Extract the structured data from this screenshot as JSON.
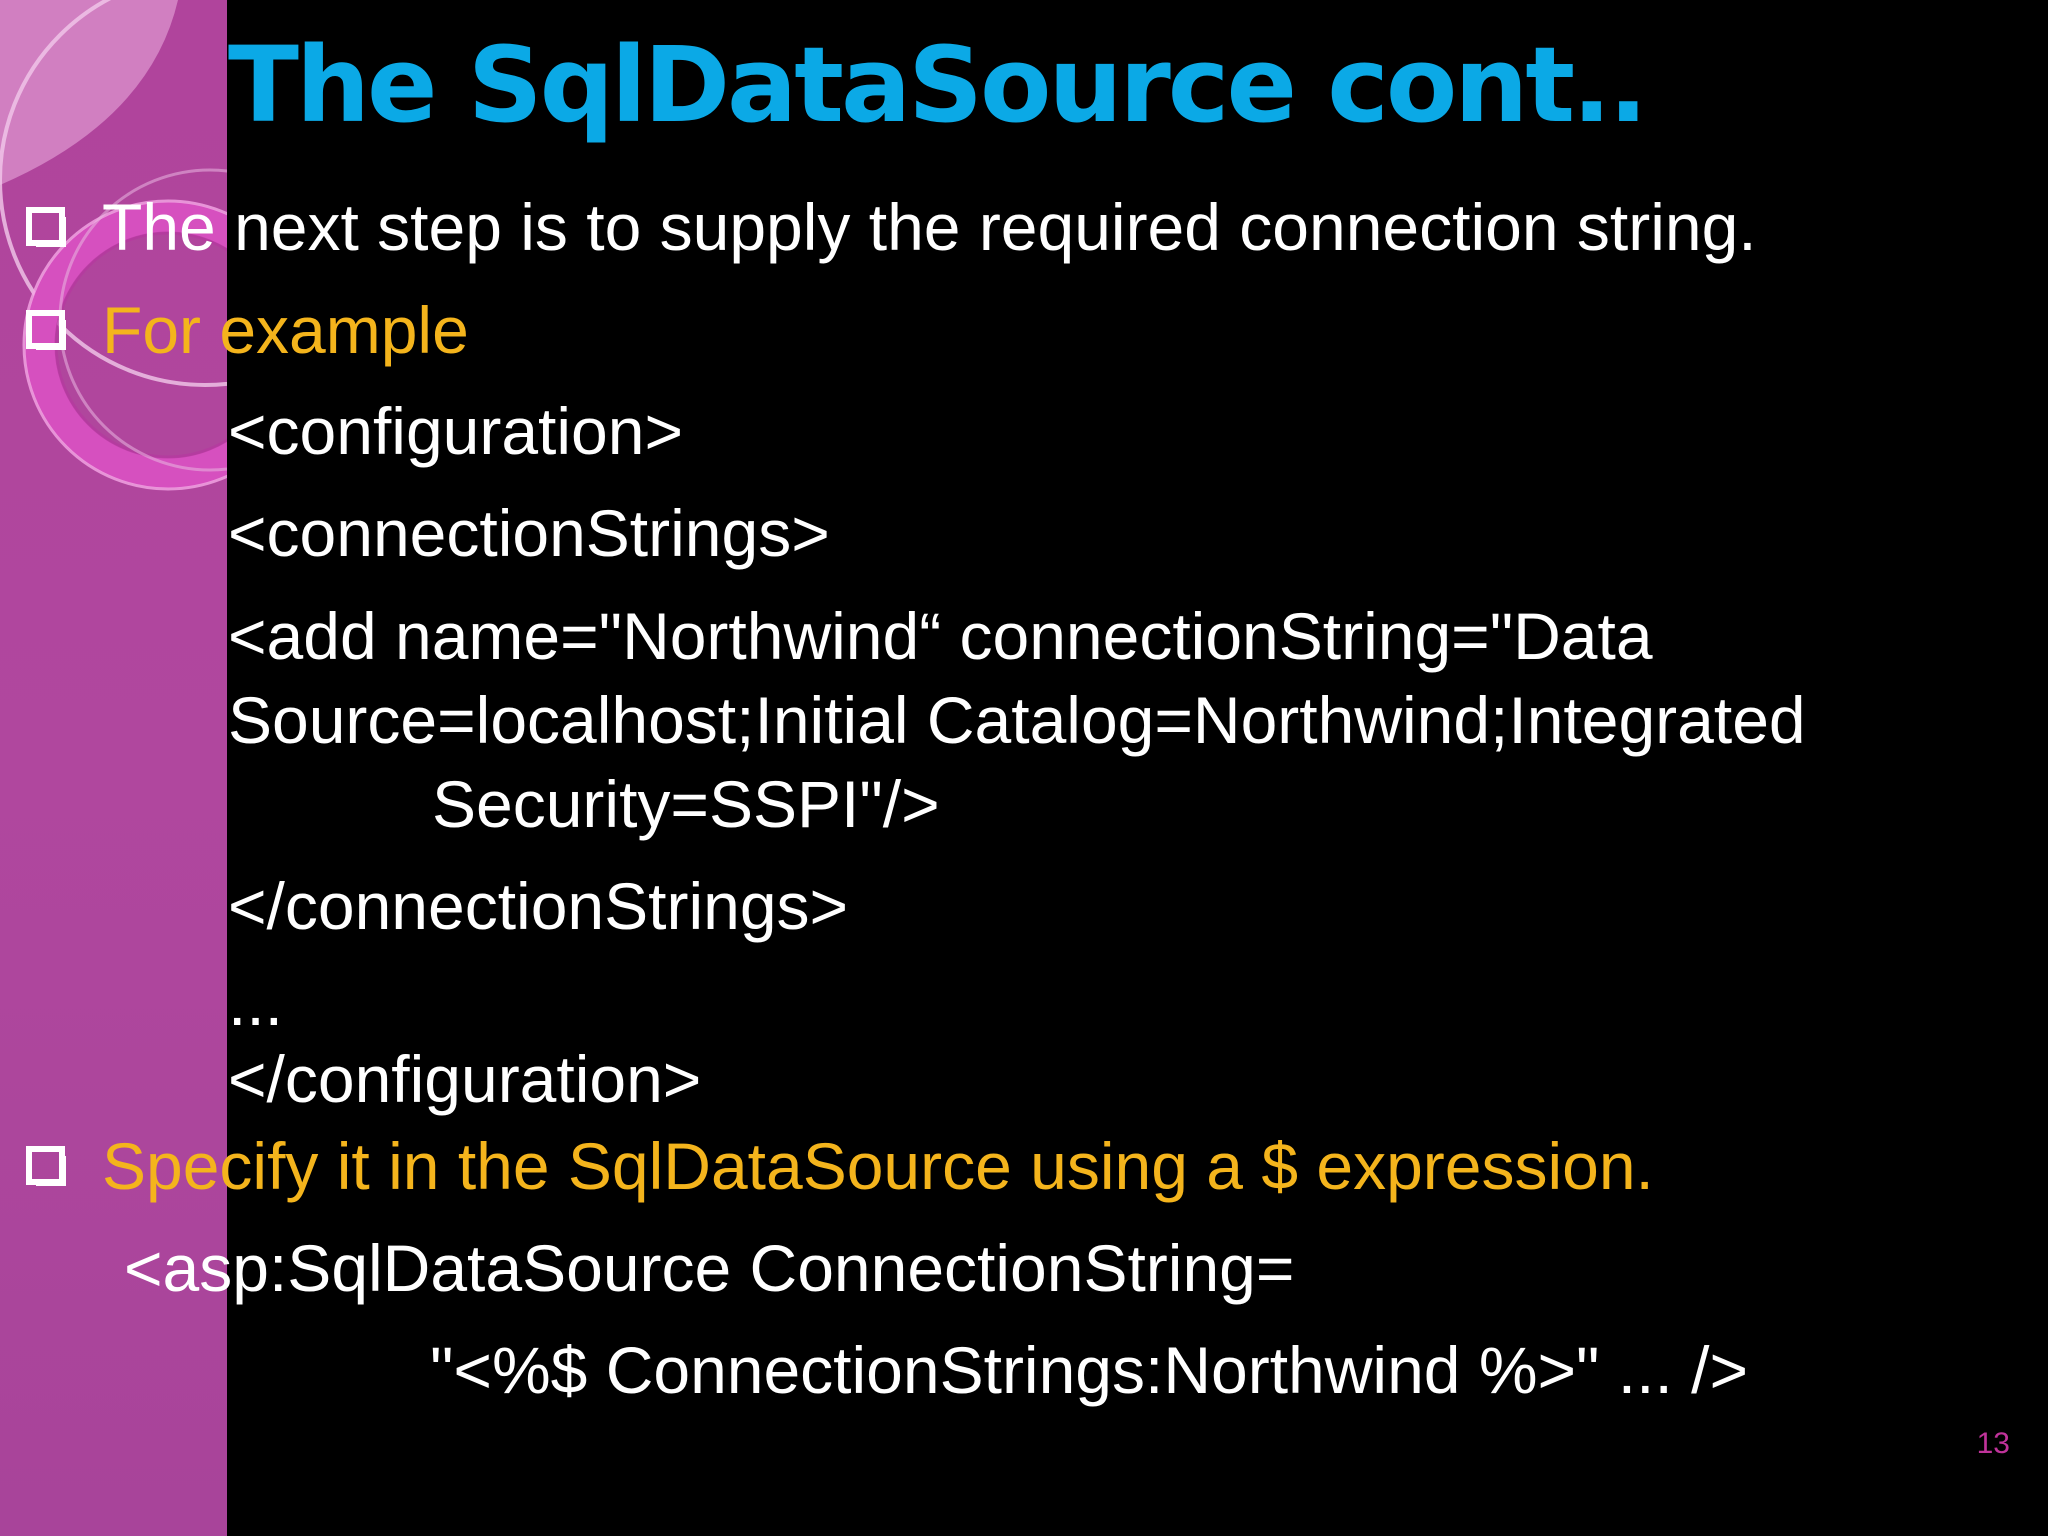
{
  "slide": {
    "title": "The SqlDataSource cont..",
    "bullets": [
      {
        "text": "The next step is to supply the required connection string."
      },
      {
        "text": "For example"
      },
      {
        "text": "Specify it in the SqlDataSource using a $ expression."
      }
    ],
    "code_config": [
      "<configuration>",
      "<connectionStrings>",
      "<add name=\"Northwind“ connectionString=\"Data",
      "Source=localhost;Initial Catalog=Northwind;Integrated",
      "Security=SSPI\"/>",
      "</connectionStrings>",
      "...",
      "</configuration>"
    ],
    "code_datasource": [
      "<asp:SqlDataSource ConnectionString=",
      "\"<%$ ConnectionStrings:Northwind %>\" ... />"
    ],
    "page_number": "13"
  },
  "colors": {
    "background": "#000000",
    "title": "#0ba9e6",
    "body_text": "#ffffff",
    "highlight_text": "#f4b41c",
    "side_band": "#b0449c",
    "page_number": "#c0339a"
  },
  "icons": {
    "bullet": "hollow-square-bullet-icon",
    "decoration": "pink-rings-decoration-icon"
  }
}
